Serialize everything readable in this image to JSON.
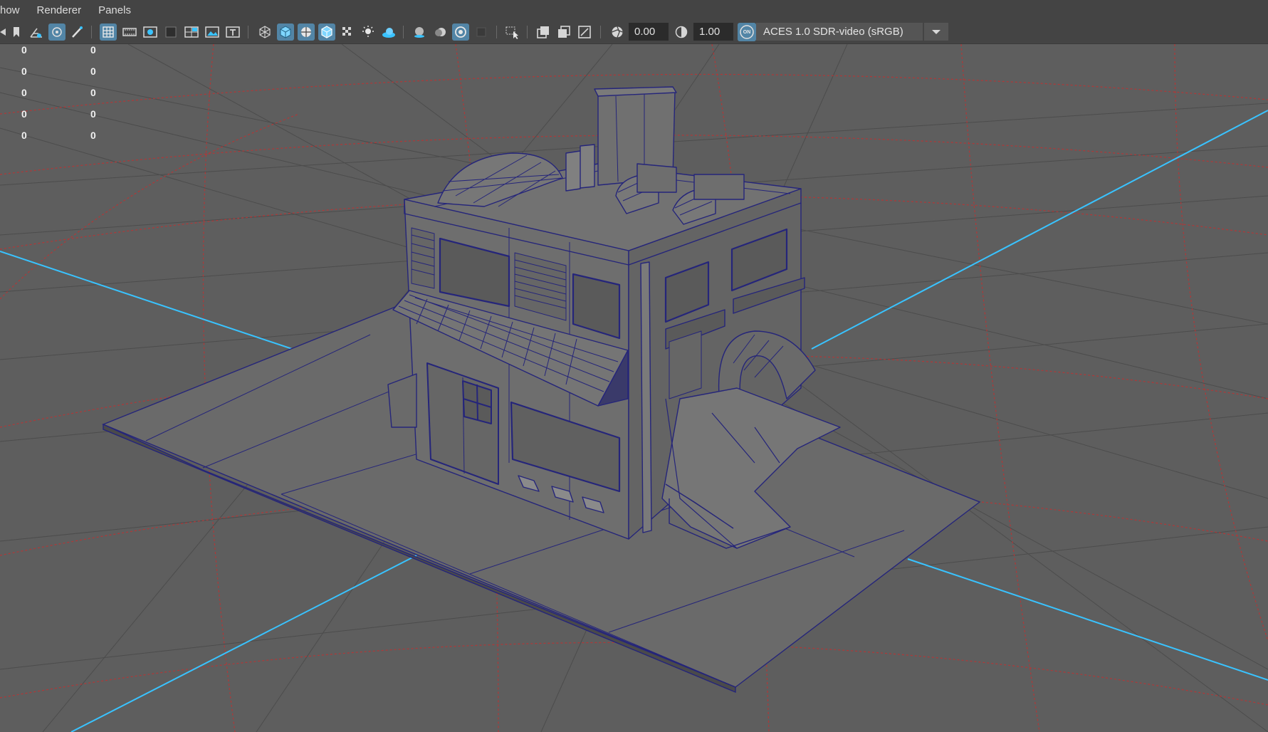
{
  "menubar": {
    "items": [
      {
        "label": "how"
      },
      {
        "label": "Renderer"
      },
      {
        "label": "Panels"
      }
    ]
  },
  "toolbar": {
    "exposure_value": "0.00",
    "gamma_value": "1.00",
    "color_management_badge": "ON",
    "color_space": "ACES 1.0 SDR-video (sRGB)",
    "icons": [
      "prev-icon",
      "bookmark-icon",
      "camera-attributes-icon",
      "snapshot-icon",
      "paint-icon",
      "grid-icon",
      "film-gate-icon",
      "resolution-gate-icon",
      "gate-mask-icon",
      "field-chart-icon",
      "safe-action-icon",
      "safe-title-icon",
      "wireframe-icon",
      "smooth-shade-icon",
      "wireframe-on-shaded-icon",
      "textured-icon",
      "default-material-icon",
      "use-all-lights-icon",
      "shadows-icon",
      "screen-space-ao-icon",
      "motion-blur-icon",
      "multisample-aa-icon",
      "depth-of-field-icon",
      "isolate-select-icon",
      "xray-icon",
      "xray-joints-icon",
      "xray-components-icon",
      "exposure-icon",
      "gamma-icon"
    ]
  },
  "hud": {
    "rows": [
      {
        "a": "0",
        "b": "0"
      },
      {
        "a": "0",
        "b": "0"
      },
      {
        "a": "0",
        "b": "0"
      },
      {
        "a": "0",
        "b": "0"
      },
      {
        "a": "0",
        "b": "0"
      }
    ]
  },
  "colors": {
    "viewport_bg": "#5e5e5e",
    "toolbar_bg": "#444444",
    "active_button": "#5285a6",
    "axis_line": "#39c3ff",
    "grid_red": "#b03838",
    "grid_gray": "#4a4a4a",
    "wireframe": "#25257a"
  }
}
